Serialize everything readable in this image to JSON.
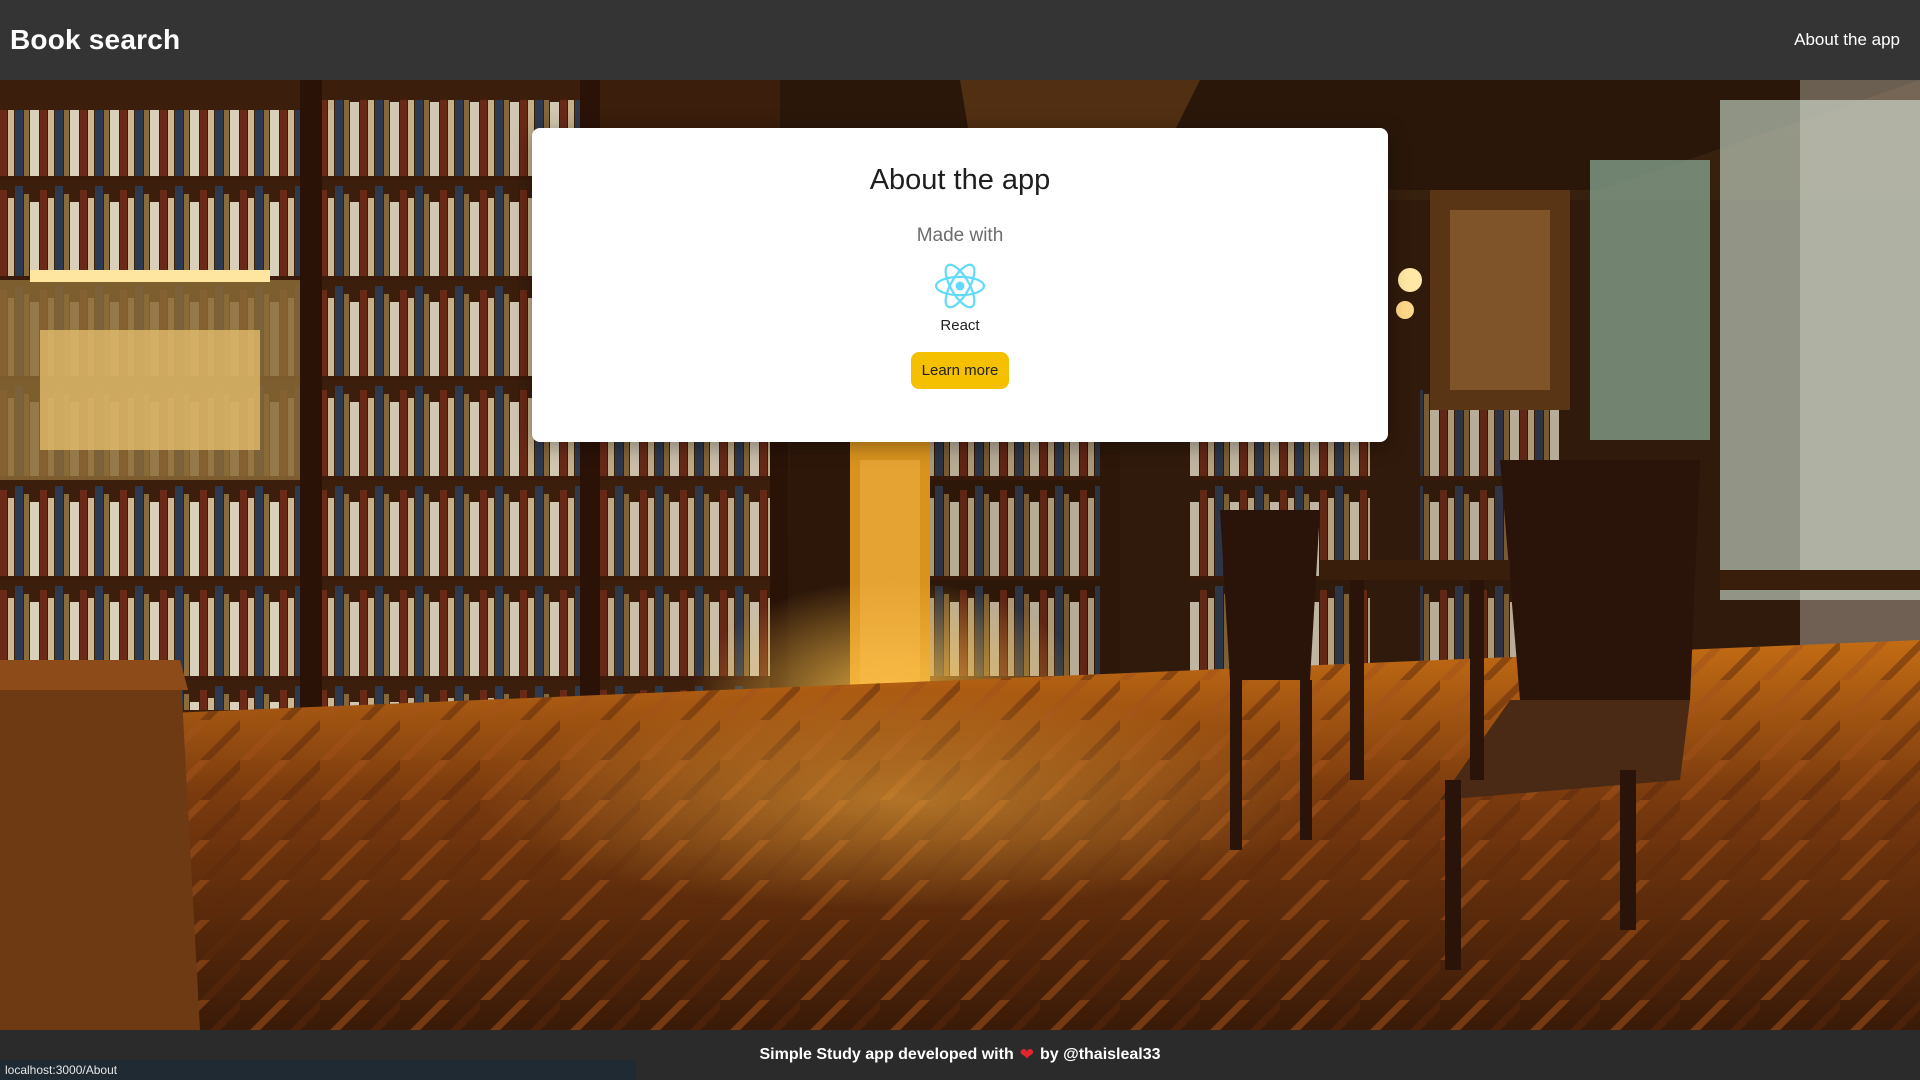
{
  "header": {
    "brand": "Book search",
    "nav_link": "About the app"
  },
  "card": {
    "title": "About the app",
    "made_with": "Made with",
    "tech_name": "React",
    "tech_icon": "react-atom-icon",
    "learn_more_label": "Learn more"
  },
  "footer": {
    "text_before": "Simple Study app developed with",
    "heart_icon": "heart-icon",
    "text_after": "by @thaisleal33"
  },
  "status_bar": {
    "url": "localhost:3000/About"
  },
  "colors": {
    "navbar": "#343434",
    "footer": "#2b2b2b",
    "button": "#f5c000",
    "react": "#61dafb",
    "heart": "#e0262d"
  }
}
